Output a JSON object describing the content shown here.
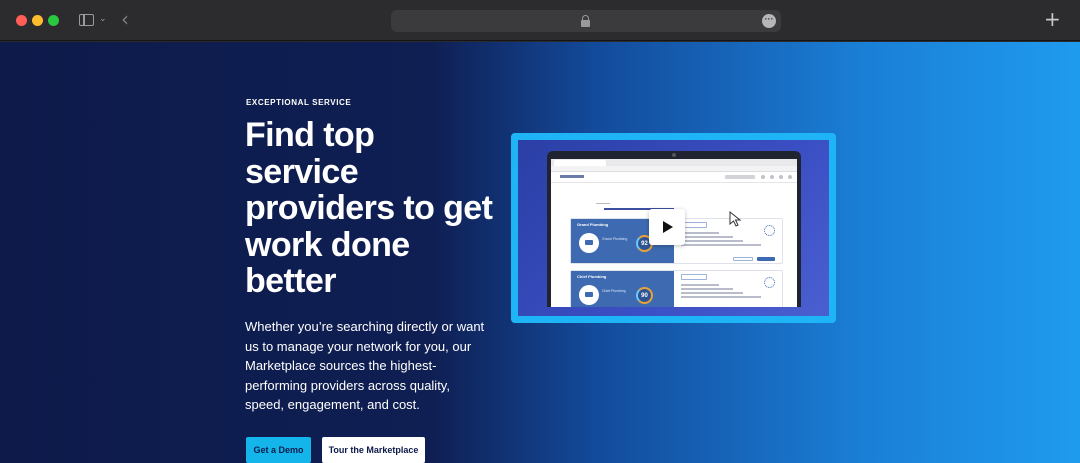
{
  "browser": {
    "icons": {
      "close": "close-dot",
      "minimize": "minimize-dot",
      "zoom": "zoom-dot",
      "sidebar": "sidebar-toggle-icon",
      "chevron": "chevron-down-icon",
      "back": "back-arrow-icon",
      "lock": "lock-icon",
      "more": "more-icon",
      "new_tab": "plus-icon"
    },
    "colors": {
      "close": "#ff5f57",
      "minimize": "#febc2e",
      "zoom": "#28c840"
    }
  },
  "hero": {
    "eyebrow": "EXCEPTIONAL SERVICE",
    "headline": "Find top service providers to get work done better",
    "body": "Whether you’re searching directly or want us to manage your network for you, our Marketplace sources the highest-performing providers across quality, speed, engagement, and cost.",
    "primary_cta": "Get a Demo",
    "secondary_cta": "Tour the Marketplace",
    "colors": {
      "background_start": "#0d1a4a",
      "background_end": "#1f9bee",
      "primary_cta": "#13b5ea",
      "video_frame": "#1fb4f5"
    }
  },
  "video": {
    "play_icon": "play-icon",
    "cursor_icon": "cursor-icon",
    "cards": [
      {
        "name": "Grand Plumbing",
        "label": "Grand Plumbing",
        "score": "92"
      },
      {
        "name": "Chief Plumbing",
        "label": "Chief Plumbing",
        "score": "90"
      }
    ]
  }
}
